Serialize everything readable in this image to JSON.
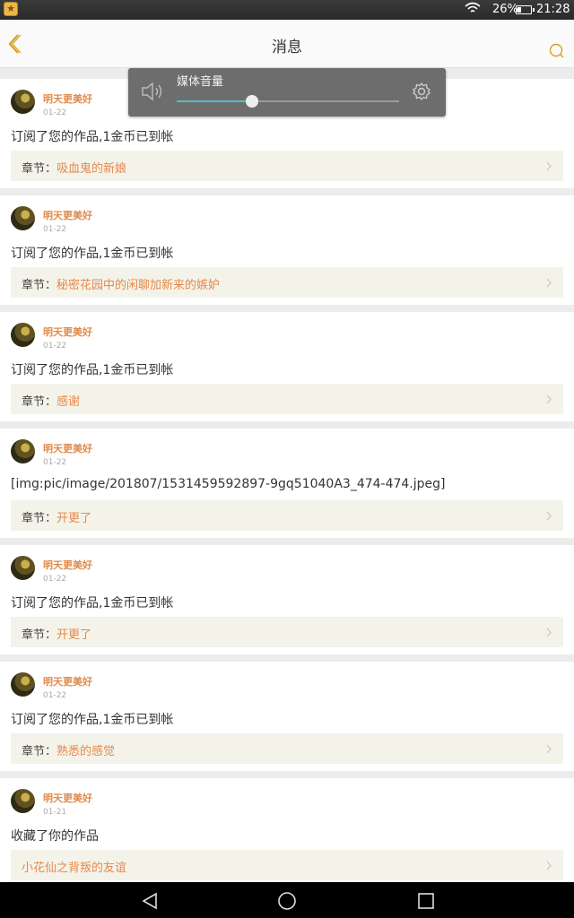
{
  "status_bar": {
    "battery_text": "26%",
    "battery_level": 0.26,
    "time": "21:28"
  },
  "header": {
    "title": "消息"
  },
  "volume_popup": {
    "label": "媒体音量",
    "level": 0.34,
    "accent_color": "#4fc0c4"
  },
  "messages": [
    {
      "user": "明天更美好",
      "date": "01-22",
      "text": "订阅了您的作品,1金币已到帐",
      "chapter_prefix": "章节：",
      "chapter": "吸血鬼的新娘"
    },
    {
      "user": "明天更美好",
      "date": "01-22",
      "text": "订阅了您的作品,1金币已到帐",
      "chapter_prefix": "章节：",
      "chapter": "秘密花园中的闲聊加新来的嫉妒"
    },
    {
      "user": "明天更美好",
      "date": "01-22",
      "text": "订阅了您的作品,1金币已到帐",
      "chapter_prefix": "章节：",
      "chapter": "感谢"
    },
    {
      "user": "明天更美好",
      "date": "01-22",
      "text": "[img:pic/image/201807/1531459592897-9gq51040A3_474-474.jpeg]",
      "chapter_prefix": "章节：",
      "chapter": "开更了"
    },
    {
      "user": "明天更美好",
      "date": "01-22",
      "text": "订阅了您的作品,1金币已到帐",
      "chapter_prefix": "章节：",
      "chapter": "开更了"
    },
    {
      "user": "明天更美好",
      "date": "01-22",
      "text": "订阅了您的作品,1金币已到帐",
      "chapter_prefix": "章节：",
      "chapter": "熟悉的感觉"
    },
    {
      "user": "明天更美好",
      "date": "01-21",
      "text": "收藏了你的作品",
      "chapter_prefix": "",
      "chapter": "小花仙之背叛的友谊"
    }
  ],
  "colors": {
    "accent": "#e5894a",
    "chapter_bg": "#f4f3ea",
    "header_icon": "#d9a020"
  },
  "icons": {
    "back": "chevron-left-icon",
    "search": "search-icon",
    "speaker": "speaker-icon",
    "settings": "gear-icon",
    "nav_back": "triangle-back-icon",
    "nav_home": "circle-home-icon",
    "nav_recent": "square-recent-icon"
  }
}
